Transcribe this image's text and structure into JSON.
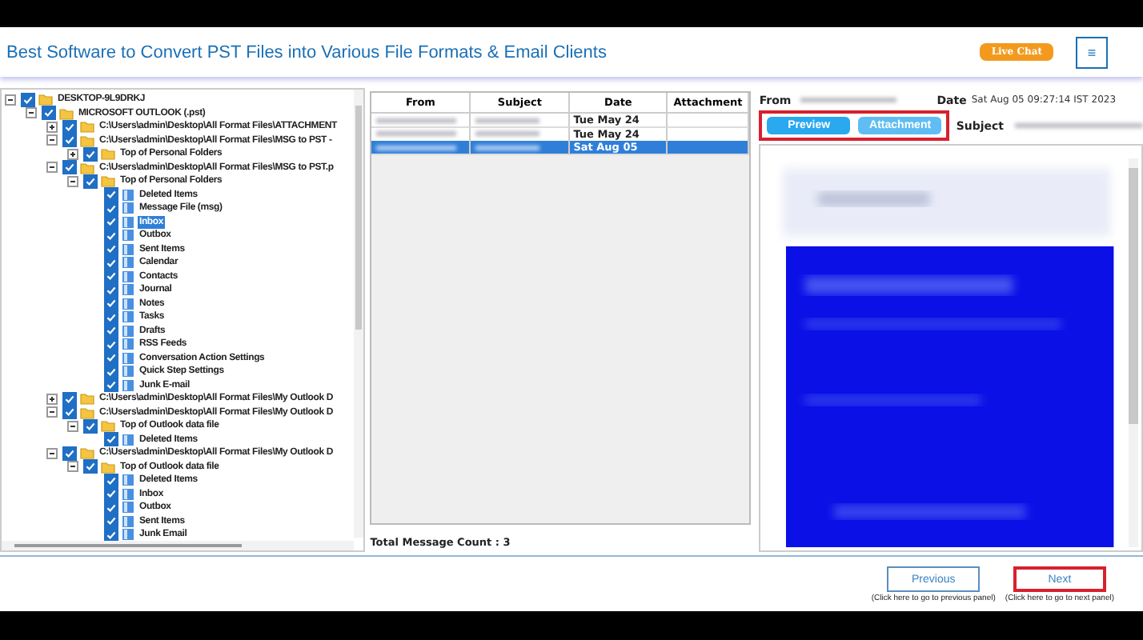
{
  "header": {
    "title": "Best Software to Convert PST Files into Various File Formats & Email Clients",
    "live_chat": "Live Chat",
    "menu_glyph": "≡"
  },
  "tree": [
    {
      "label": "DESKTOP-9L9DRKJ",
      "kind": "folder",
      "checked": true,
      "expanded": true,
      "selected": false,
      "children": [
        {
          "label": "MICROSOFT OUTLOOK (.pst)",
          "kind": "folder",
          "checked": true,
          "expanded": true,
          "selected": false,
          "children": [
            {
              "label": "C:\\Users\\admin\\Desktop\\All Format Files\\ATTACHMENT",
              "kind": "folder",
              "checked": true,
              "expanded": false,
              "selected": false
            },
            {
              "label": "C:\\Users\\admin\\Desktop\\All Format Files\\MSG to PST -",
              "kind": "folder",
              "checked": true,
              "expanded": true,
              "selected": false,
              "children": [
                {
                  "label": "Top of Personal Folders",
                  "kind": "folder",
                  "checked": true,
                  "expanded": false,
                  "selected": false
                }
              ]
            },
            {
              "label": "C:\\Users\\admin\\Desktop\\All Format Files\\MSG to PST.p",
              "kind": "folder",
              "checked": true,
              "expanded": true,
              "selected": false,
              "children": [
                {
                  "label": "Top of Personal Folders",
                  "kind": "folder",
                  "checked": true,
                  "expanded": true,
                  "selected": false,
                  "children": [
                    {
                      "label": "Deleted Items",
                      "kind": "page",
                      "checked": true,
                      "selected": false
                    },
                    {
                      "label": "Message File (msg)",
                      "kind": "page",
                      "checked": true,
                      "selected": false
                    },
                    {
                      "label": "Inbox",
                      "kind": "page",
                      "checked": true,
                      "selected": true
                    },
                    {
                      "label": "Outbox",
                      "kind": "page",
                      "checked": true,
                      "selected": false
                    },
                    {
                      "label": "Sent Items",
                      "kind": "page",
                      "checked": true,
                      "selected": false
                    },
                    {
                      "label": "Calendar",
                      "kind": "page",
                      "checked": true,
                      "selected": false
                    },
                    {
                      "label": "Contacts",
                      "kind": "page",
                      "checked": true,
                      "selected": false
                    },
                    {
                      "label": "Journal",
                      "kind": "page",
                      "checked": true,
                      "selected": false
                    },
                    {
                      "label": "Notes",
                      "kind": "page",
                      "checked": true,
                      "selected": false
                    },
                    {
                      "label": "Tasks",
                      "kind": "page",
                      "checked": true,
                      "selected": false
                    },
                    {
                      "label": "Drafts",
                      "kind": "page",
                      "checked": true,
                      "selected": false
                    },
                    {
                      "label": "RSS Feeds",
                      "kind": "page",
                      "checked": true,
                      "selected": false
                    },
                    {
                      "label": "Conversation Action Settings",
                      "kind": "page",
                      "checked": true,
                      "selected": false
                    },
                    {
                      "label": "Quick Step Settings",
                      "kind": "page",
                      "checked": true,
                      "selected": false
                    },
                    {
                      "label": "Junk E-mail",
                      "kind": "page",
                      "checked": true,
                      "selected": false
                    }
                  ]
                }
              ]
            },
            {
              "label": "C:\\Users\\admin\\Desktop\\All Format Files\\My Outlook D",
              "kind": "folder",
              "checked": true,
              "expanded": false,
              "selected": false
            },
            {
              "label": "C:\\Users\\admin\\Desktop\\All Format Files\\My Outlook D",
              "kind": "folder",
              "checked": true,
              "expanded": true,
              "selected": false,
              "children": [
                {
                  "label": "Top of Outlook data file",
                  "kind": "folder",
                  "checked": true,
                  "expanded": true,
                  "selected": false,
                  "children": [
                    {
                      "label": "Deleted Items",
                      "kind": "page",
                      "checked": true,
                      "selected": false
                    }
                  ]
                }
              ]
            },
            {
              "label": "C:\\Users\\admin\\Desktop\\All Format Files\\My Outlook D",
              "kind": "folder",
              "checked": true,
              "expanded": true,
              "selected": false,
              "children": [
                {
                  "label": "Top of Outlook data file",
                  "kind": "folder",
                  "checked": true,
                  "expanded": true,
                  "selected": false,
                  "children": [
                    {
                      "label": "Deleted Items",
                      "kind": "page",
                      "checked": true,
                      "selected": false
                    },
                    {
                      "label": "Inbox",
                      "kind": "page",
                      "checked": true,
                      "selected": false
                    },
                    {
                      "label": "Outbox",
                      "kind": "page",
                      "checked": true,
                      "selected": false
                    },
                    {
                      "label": "Sent Items",
                      "kind": "page",
                      "checked": true,
                      "selected": false
                    },
                    {
                      "label": "Junk Email",
                      "kind": "page",
                      "checked": true,
                      "selected": false
                    }
                  ]
                }
              ]
            }
          ]
        }
      ]
    }
  ],
  "messages": {
    "columns": [
      "From",
      "Subject",
      "Date",
      "Attachment"
    ],
    "rows": [
      {
        "date": "Tue May 24",
        "selected": false
      },
      {
        "date": "Tue May 24",
        "selected": false
      },
      {
        "date": "Sat Aug 05",
        "selected": true
      }
    ],
    "total": "Total Message Count : 3"
  },
  "preview": {
    "from_label": "From",
    "date_label": "Date",
    "date": "Sat Aug 05 09:27:14 IST 2023",
    "subject_label": "Subject",
    "highlighted": true,
    "tabs": [
      {
        "label": "Preview",
        "selected": true
      },
      {
        "label": "Attachment",
        "selected": false
      }
    ]
  },
  "footer": {
    "buttons": [
      {
        "label": "Previous",
        "caption": "(Click here to go to previous panel)",
        "highlighted": false
      },
      {
        "label": "Next",
        "caption": "(Click here to go to next panel)",
        "highlighted": true
      }
    ]
  }
}
